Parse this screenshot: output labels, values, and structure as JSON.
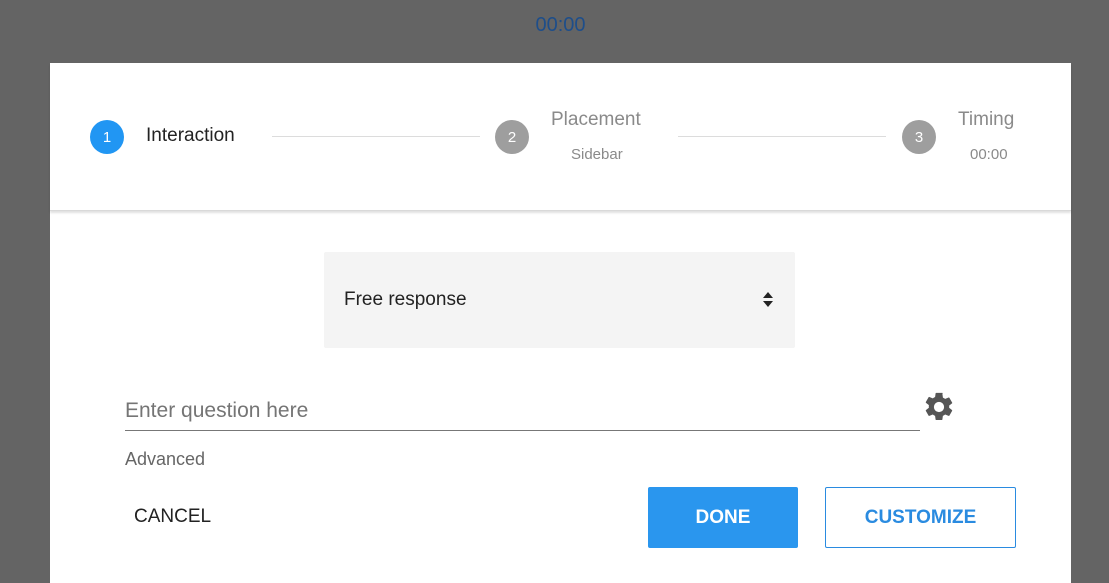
{
  "header": {
    "timer": "00:00"
  },
  "stepper": {
    "steps": [
      {
        "number": "1",
        "title": "Interaction",
        "subtitle": ""
      },
      {
        "number": "2",
        "title": "Placement",
        "subtitle": "Sidebar"
      },
      {
        "number": "3",
        "title": "Timing",
        "subtitle": "00:00"
      }
    ]
  },
  "form": {
    "interaction_type": {
      "selected": "Free response"
    },
    "question": {
      "value": "",
      "placeholder": "Enter question here"
    },
    "advanced_label": "Advanced"
  },
  "actions": {
    "cancel_label": "CANCEL",
    "done_label": "DONE",
    "customize_label": "CUSTOMIZE"
  },
  "colors": {
    "accent": "#2a96ee",
    "step_active": "#2196f3",
    "step_inactive": "#9e9e9e",
    "overlay": "#646464"
  },
  "icons": {
    "settings": "gear-icon",
    "select": "sort-arrows-icon"
  }
}
